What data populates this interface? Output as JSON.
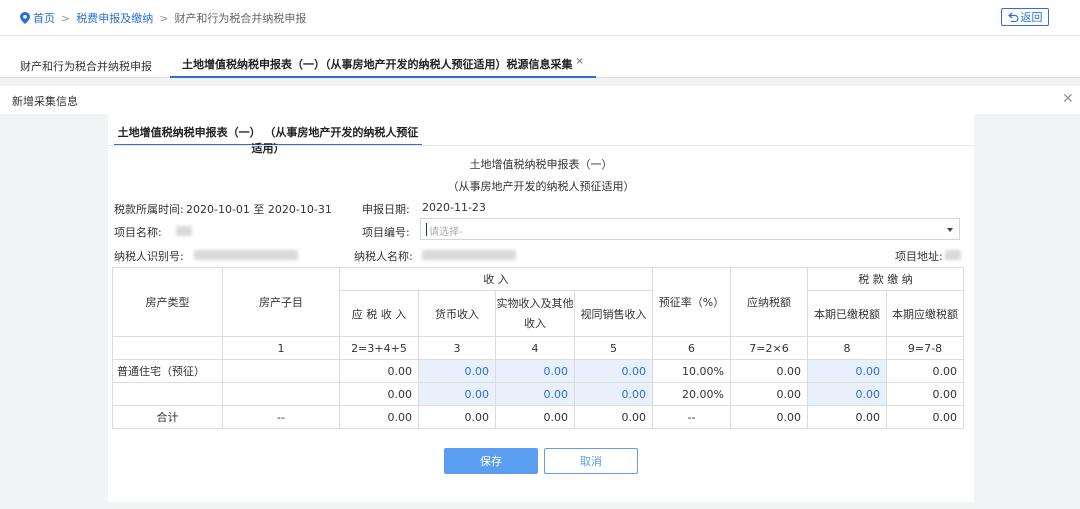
{
  "breadcrumb": {
    "home": "首页",
    "level1": "税费申报及缴纳",
    "current": "财产和行为税合并纳税申报",
    "separator": ">"
  },
  "back_button": {
    "icon": "return-icon",
    "label": "返回"
  },
  "tabs": [
    {
      "label": "财产和行为税合并纳税申报"
    },
    {
      "label": "土地增值税纳税申报表（一）（从事房地产开发的纳税人预征适用）税源信息采集",
      "close": "×"
    }
  ],
  "dialog": {
    "title": "新增采集信息",
    "close": "✕"
  },
  "card": {
    "tab_label": "土地增值税纳税申报表（一） （从事房地产开发的纳税人预征适用）",
    "form_title": "土地增值税纳税申报表（一）",
    "form_subtitle": "（从事房地产开发的纳税人预征适用）",
    "tax_period_label": "税款所属时间:",
    "tax_period_value": "2020-10-01 至 2020-10-31",
    "filing_date_label": "申报日期:",
    "filing_date_value": "2020-11-23",
    "project_name_label": "项目名称:",
    "project_no_label": "项目编号:",
    "project_no_placeholder": "请选择-",
    "taxpayer_id_label": "纳税人识别号:",
    "taxpayer_name_label": "纳税人名称:",
    "project_address_label": "项目地址:"
  },
  "table": {
    "h_type": "房产类型",
    "h_subitem": "房产子目",
    "h_income": "收  入",
    "h_taxable_income": "应 税 收 入",
    "h_currency_income": "货币收入",
    "h_in_kind_income": "实物收入及其他收入",
    "h_deemed_sales": "视同销售收入",
    "h_prepay_rate": "预征率（%）",
    "h_tax_payable": "应纳税额",
    "h_tax_payment": "税 款 缴 纳",
    "h_paid": "本期已缴税额",
    "h_due": "本期应缴税额",
    "index_row": [
      "1",
      "2=3+4+5",
      "3",
      "4",
      "5",
      "6",
      "7=2×6",
      "8",
      "9=7-8"
    ],
    "rows": [
      {
        "type": "普通住宅（预征）",
        "sub": "",
        "taxable": "0.00",
        "currency": "0.00",
        "in_kind": "0.00",
        "deemed": "0.00",
        "rate": "10.00%",
        "payable": "0.00",
        "paid": "0.00",
        "due": "0.00"
      },
      {
        "type": "",
        "sub": "",
        "taxable": "0.00",
        "currency": "0.00",
        "in_kind": "0.00",
        "deemed": "0.00",
        "rate": "20.00%",
        "payable": "0.00",
        "paid": "0.00",
        "due": "0.00"
      }
    ],
    "total": {
      "type": "合计",
      "sub": "--",
      "taxable": "0.00",
      "currency": "0.00",
      "in_kind": "0.00",
      "deemed": "0.00",
      "rate": "--",
      "payable": "0.00",
      "paid": "0.00",
      "due": "0.00"
    }
  },
  "buttons": {
    "save": "保存",
    "cancel": "取消"
  },
  "colors": {
    "accent": "#2d6fd6",
    "button_primary": "#5b9df0",
    "editable_cell": "#e8f1fb"
  }
}
